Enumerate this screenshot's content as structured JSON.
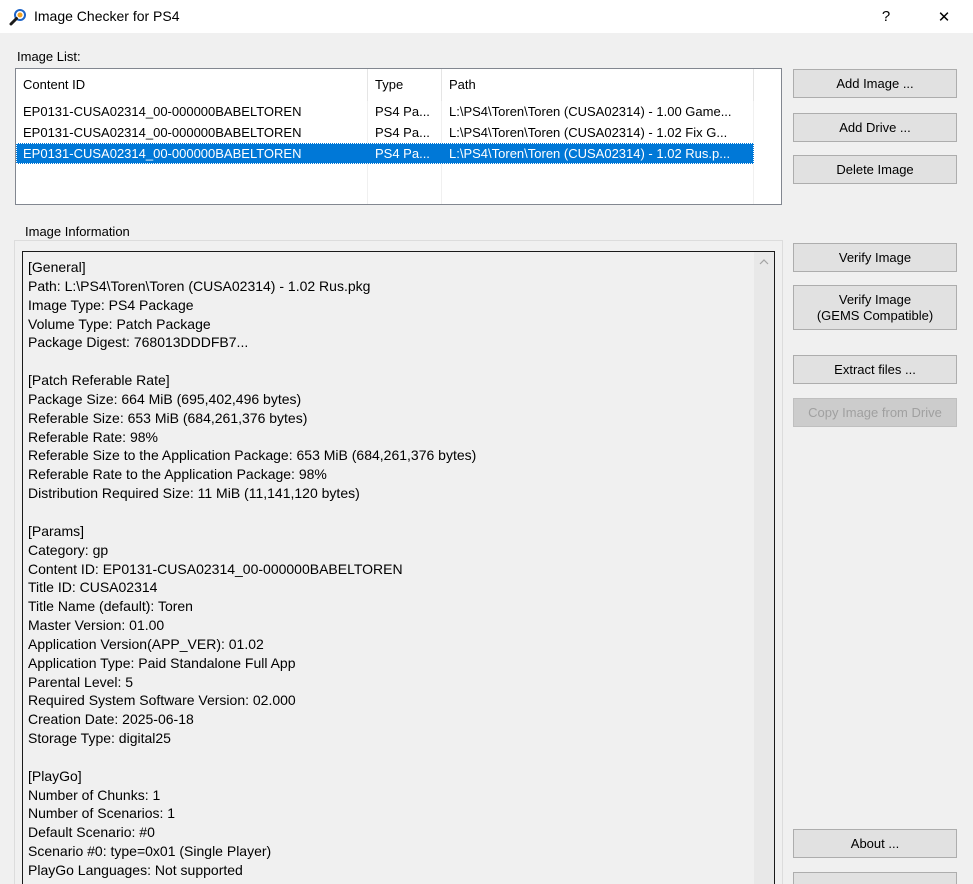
{
  "window": {
    "title": "Image Checker for PS4",
    "help_glyph": "?",
    "close_glyph": "✕"
  },
  "image_list": {
    "label": "Image List:",
    "columns": [
      "Content ID",
      "Type",
      "Path"
    ],
    "rows": [
      [
        "EP0131-CUSA02314_00-000000BABELTOREN",
        "PS4 Pa...",
        "L:\\PS4\\Toren\\Toren (CUSA02314) - 1.00 Game..."
      ],
      [
        "EP0131-CUSA02314_00-000000BABELTOREN",
        "PS4 Pa...",
        "L:\\PS4\\Toren\\Toren (CUSA02314) - 1.02 Fix G..."
      ],
      [
        "EP0131-CUSA02314_00-000000BABELTOREN",
        "PS4 Pa...",
        "L:\\PS4\\Toren\\Toren (CUSA02314) - 1.02 Rus.p..."
      ]
    ],
    "selected_index": 2
  },
  "buttons": {
    "add_image": "Add Image ...",
    "add_drive": "Add Drive ...",
    "delete_image": "Delete Image",
    "verify_image": "Verify Image",
    "verify_gems": "Verify Image\n(GEMS Compatible)",
    "extract_files": "Extract files ...",
    "copy_from_drive": "Copy Image from Drive",
    "about": "About ..."
  },
  "image_information": {
    "label": "Image Information",
    "text": "[General]\nPath: L:\\PS4\\Toren\\Toren (CUSA02314) - 1.02 Rus.pkg\nImage Type: PS4 Package\nVolume Type: Patch Package\nPackage Digest: 768013DDDFB7...\n\n[Patch Referable Rate]\nPackage Size: 664 MiB (695,402,496 bytes)\nReferable Size: 653 MiB (684,261,376 bytes)\nReferable Rate: 98%\nReferable Size to the Application Package: 653 MiB (684,261,376 bytes)\nReferable Rate to the Application Package: 98%\nDistribution Required Size: 11 MiB (11,141,120 bytes)\n\n[Params]\nCategory: gp\nContent ID: EP0131-CUSA02314_00-000000BABELTOREN\nTitle ID: CUSA02314\nTitle Name (default): Toren\nMaster Version: 01.00\nApplication Version(APP_VER): 01.02\nApplication Type: Paid Standalone Full App\nParental Level: 5\nRequired System Software Version: 02.000\nCreation Date: 2025-06-18\nStorage Type: digital25\n\n[PlayGo]\nNumber of Chunks: 1\nNumber of Scenarios: 1\nDefault Scenario: #0\nScenario #0: type=0x01 (Single Player)\nPlayGo Languages: Not supported"
  },
  "colors": {
    "selection": "#0078d7",
    "window_bg": "#f0f0f0",
    "button_bg": "#e1e1e1"
  }
}
